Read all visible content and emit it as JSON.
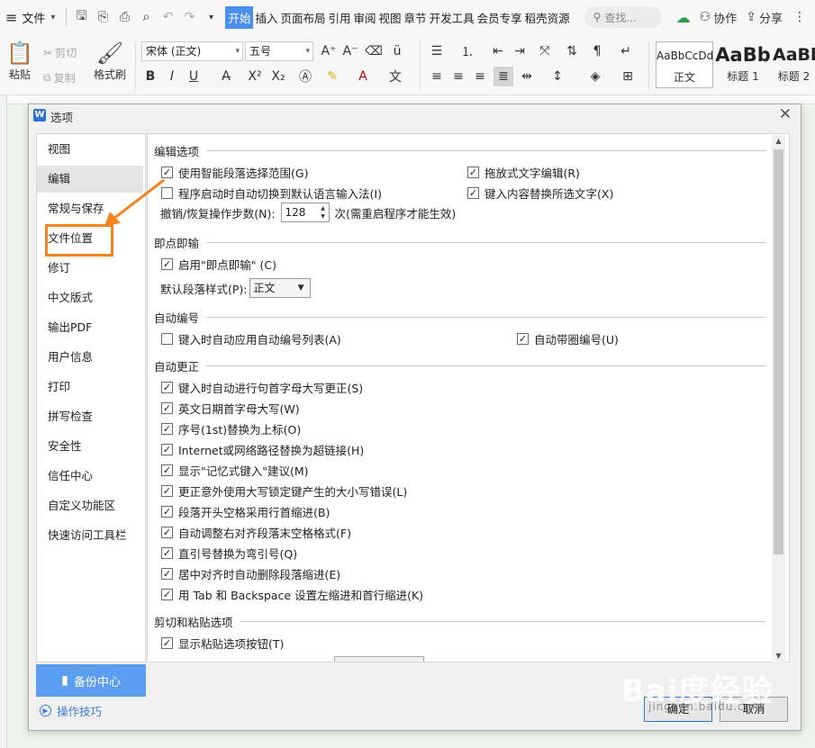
{
  "menubar": {
    "file_label": "文件",
    "tabs": [
      "开始",
      "插入",
      "页面布局",
      "引用",
      "审阅",
      "视图",
      "章节",
      "开发工具",
      "会员专享",
      "稻壳资源"
    ],
    "active_tab": "开始",
    "search_placeholder": "查找...",
    "collab_label": "协作",
    "share_label": "分享"
  },
  "ribbon": {
    "paste_label": "粘贴",
    "cut_label": "剪切",
    "copy_label": "复制",
    "format_painter_label": "格式刷",
    "font_name": "宋体 (正文)",
    "font_size": "五号",
    "styles": [
      {
        "preview": "AaBbCcDd",
        "name": "正文"
      },
      {
        "preview": "AaBb",
        "name": "标题 1"
      },
      {
        "preview": "AaBl",
        "name": "标题 2"
      }
    ]
  },
  "dialog": {
    "title": "选项",
    "nav_items": [
      "视图",
      "编辑",
      "常规与保存",
      "文件位置",
      "修订",
      "中文版式",
      "输出PDF",
      "用户信息",
      "打印",
      "拼写检查",
      "安全性",
      "信任中心",
      "自定义功能区",
      "快速访问工具栏"
    ],
    "selected_nav": "编辑",
    "highlighted_nav": "文件位置",
    "backup_label": "备份中心",
    "tips_label": "操作技巧",
    "ok_label": "确定",
    "cancel_label": "取消",
    "sections": {
      "edit_options": {
        "title": "编辑选项",
        "smart_select": {
          "label": "使用智能段落选择范围(G)",
          "checked": true
        },
        "drag_drop": {
          "label": "拖放式文字编辑(R)",
          "checked": true
        },
        "auto_ime": {
          "label": "程序启动时自动切换到默认语言输入法(I)",
          "checked": false
        },
        "replace_select": {
          "label": "键入内容替换所选文字(X)",
          "checked": true
        },
        "undo_label": "撤销/恢复操作步数(N):",
        "undo_value": "128",
        "undo_note": "次(需重启程序才能生效)"
      },
      "click_type": {
        "title": "即点即输",
        "enable": {
          "label": "启用\"即点即输\" (C)",
          "checked": true
        },
        "default_style_label": "默认段落样式(P):",
        "default_style_value": "正文"
      },
      "auto_number": {
        "title": "自动编号",
        "auto_list": {
          "label": "键入时自动应用自动编号列表(A)",
          "checked": false
        },
        "auto_circle": {
          "label": "自动带圈编号(U)",
          "checked": true
        }
      },
      "autocorrect": {
        "title": "自动更正",
        "items": [
          {
            "label": "键入时自动进行句首字母大写更正(S)",
            "checked": true
          },
          {
            "label": "英文日期首字母大写(W)",
            "checked": true
          },
          {
            "label": "序号(1st)替换为上标(O)",
            "checked": true
          },
          {
            "label": "Internet或网络路径替换为超链接(H)",
            "checked": true
          },
          {
            "label": "显示\"记忆式键入\"建议(M)",
            "checked": true
          },
          {
            "label": "更正意外使用大写锁定键产生的大小写错误(L)",
            "checked": true
          },
          {
            "label": "段落开头空格采用行首缩进(B)",
            "checked": true
          },
          {
            "label": "自动调整右对齐段落末空格格式(F)",
            "checked": true
          },
          {
            "label": "直引号替换为弯引号(Q)",
            "checked": true
          },
          {
            "label": "居中对齐时自动删除段落缩进(E)",
            "checked": true
          },
          {
            "label": "用 Tab 和 Backspace 设置左缩进和首行缩进(K)",
            "checked": true
          }
        ]
      },
      "paste_options": {
        "title": "剪切和粘贴选项",
        "show_paste_btn": {
          "label": "显示粘贴选项按钮(T)",
          "checked": true
        }
      }
    }
  },
  "watermark": {
    "brand": "Bai度经验",
    "url": "jingyan.baidu.com"
  },
  "colors": {
    "accent": "#4a8ef0",
    "highlight": "#f5831f",
    "backup_bg": "#5b9df0"
  }
}
